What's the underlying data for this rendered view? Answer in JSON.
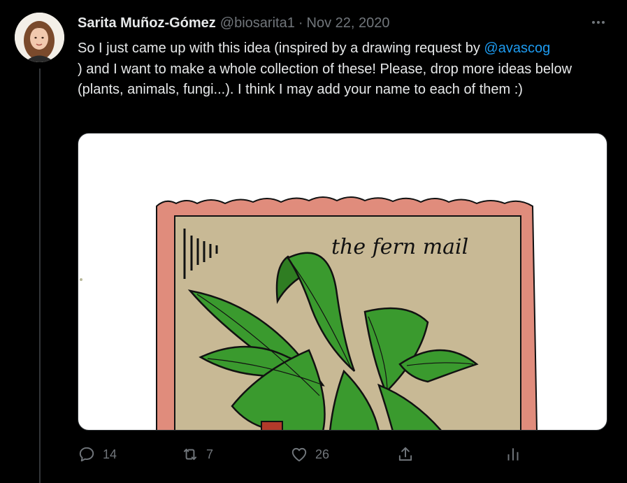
{
  "tweet": {
    "author": {
      "display_name": "Sarita Muñoz-Gómez",
      "handle": "@biosarita1"
    },
    "separator": "·",
    "date": "Nov 22, 2020",
    "text_segments": [
      "So I just came up with this idea (inspired by a drawing request by ",
      "@avascog",
      " ) and I want to make a whole collection of these! Please, drop more ideas below (plants, animals, fungi...). I think I may add your name to each of them :)"
    ],
    "media": {
      "handwritten_text": "the fern mail"
    },
    "actions": {
      "reply_count": "14",
      "retweet_count": "7",
      "like_count": "26"
    },
    "icons": {
      "more": "more-horizontal-icon",
      "reply": "reply-icon",
      "retweet": "retweet-icon",
      "like": "heart-icon",
      "share": "share-icon",
      "analytics": "analytics-icon"
    },
    "colors": {
      "background": "#000000",
      "text": "#e7e9ea",
      "secondary": "#71767b",
      "link": "#1d9bf0",
      "stamp_border": "#e08c7c",
      "stamp_paper": "#c8b995",
      "leaf": "#3a9a2e"
    }
  }
}
